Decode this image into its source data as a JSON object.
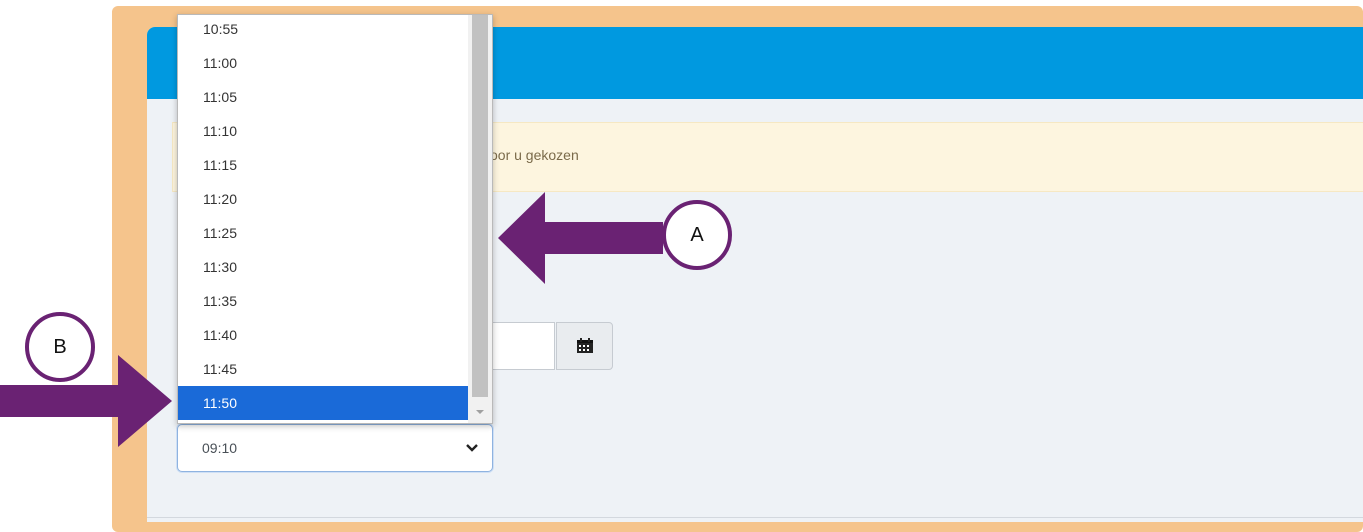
{
  "alert": {
    "text": "voor u gekozen"
  },
  "time_dropdown": {
    "options": [
      "10:55",
      "11:00",
      "11:05",
      "11:10",
      "11:15",
      "11:20",
      "11:25",
      "11:30",
      "11:35",
      "11:40",
      "11:45",
      "11:50"
    ],
    "selected_index": 11
  },
  "time_select": {
    "value": "09:10",
    "icon": "chevron-down-icon"
  },
  "date_field": {
    "value": "",
    "button_icon": "calendar-icon"
  },
  "callouts": {
    "a": "A",
    "b": "B"
  },
  "colors": {
    "frame": "#f5c48c",
    "header": "#0099e0",
    "alert_bg": "#fdf5df",
    "selected_option": "#1a6ad8",
    "annotation": "#6a2273"
  }
}
